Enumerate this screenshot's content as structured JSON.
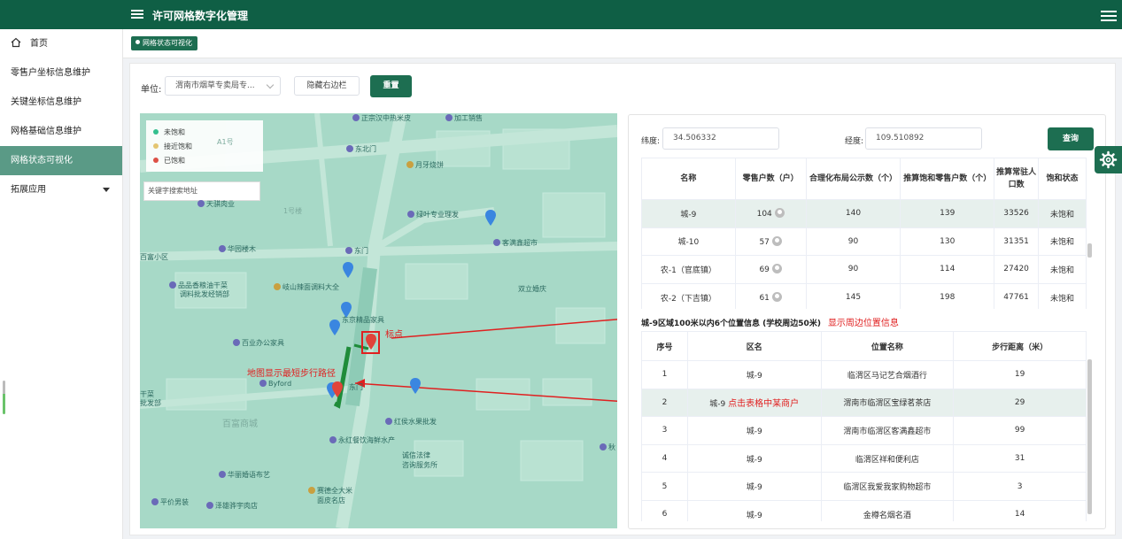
{
  "app": {
    "title": "许可网格数字化管理"
  },
  "sidebar": {
    "items": [
      {
        "label": "首页",
        "icon": "home-icon"
      },
      {
        "label": "零售户坐标信息维护"
      },
      {
        "label": "关键坐标信息维护"
      },
      {
        "label": "网格基础信息维护"
      },
      {
        "label": "网格状态可视化",
        "active": true
      },
      {
        "label": "拓展应用",
        "expandable": true
      }
    ]
  },
  "tabs": [
    {
      "label": "网格状态可视化"
    }
  ],
  "filters": {
    "unit_label": "单位:",
    "unit_value": "渭南市烟草专卖局专...",
    "hide_sidebar_label": "隐藏右边栏",
    "reset_label": "重置"
  },
  "map": {
    "legend": [
      {
        "label": "未饱和",
        "color": "#2bbd8a"
      },
      {
        "label": "接近饱和",
        "color": "#e9c46a"
      },
      {
        "label": "已饱和",
        "color": "#e0443a"
      }
    ],
    "search_placeholder": "关键字搜索地址",
    "pois": [
      "正宗汉中热米皮",
      "加工销售",
      "A1号",
      "东北门",
      "月牙烧饼",
      "天骐肉业",
      "1号楼",
      "绿叶专业理发",
      "客满鑫超市",
      "华园楼木",
      "东门",
      "百富小区",
      "品品香粮油干菜",
      "调料批发经销部",
      "岐山辣面调料大全",
      "双立婚庆",
      "东京精品家具",
      "百业办公家具",
      "Byford",
      "干菜",
      "批发部",
      "东门",
      "红侯水果批发",
      "百富商城",
      "永红餐饮海鲜水产",
      "诚信法律",
      "咨询服务所",
      "华丽婚语布艺",
      "赛德全大米",
      "面皮名店",
      "平价男装",
      "泽雄骅宇肉店",
      "秋"
    ],
    "annotations": {
      "marker": "标点",
      "route": "地图显示最短步行路径",
      "show_nearby": "显示周边位置信息",
      "click_row": "点击表格中某商户"
    }
  },
  "query": {
    "lat_label": "纬度:",
    "lat_value": "34.506332",
    "lng_label": "经度:",
    "lng_value": "109.510892",
    "query_label": "查询"
  },
  "grid_table": {
    "headers": [
      "名称",
      "零售户数（户）",
      "合理化布局公示数（个）",
      "推算饱和零售户数（个）",
      "推算常驻人口数",
      "饱和状态"
    ],
    "rows": [
      [
        "城-9",
        "104",
        "140",
        "139",
        "33526",
        "未饱和"
      ],
      [
        "城-10",
        "57",
        "90",
        "130",
        "31351",
        "未饱和"
      ],
      [
        "农-1（官底镇）",
        "69",
        "90",
        "114",
        "27420",
        "未饱和"
      ],
      [
        "农-2（下吉镇）",
        "61",
        "145",
        "198",
        "47761",
        "未饱和"
      ]
    ]
  },
  "nearby": {
    "title": "城-9区域100米以内6个位置信息 (学校周边50米)",
    "headers": [
      "序号",
      "区名",
      "位置名称",
      "步行距离（米）"
    ],
    "rows": [
      [
        "1",
        "城-9",
        "临渭区马记艺合烟酒行",
        "19"
      ],
      [
        "2",
        "城-9",
        "渭南市临渭区宝绿茗茶店",
        "29"
      ],
      [
        "3",
        "城-9",
        "渭南市临渭区客满鑫超市",
        "99"
      ],
      [
        "4",
        "城-9",
        "临渭区祥和便利店",
        "31"
      ],
      [
        "5",
        "城-9",
        "临渭区我爱我家购物超市",
        "3"
      ],
      [
        "6",
        "城-9",
        "金樽名烟名酒",
        "14"
      ]
    ]
  },
  "colors": {
    "brand": "#0f5f45",
    "accent": "#1d6e51",
    "map_bg": "#a6d8c6",
    "annotation": "#e02020"
  }
}
